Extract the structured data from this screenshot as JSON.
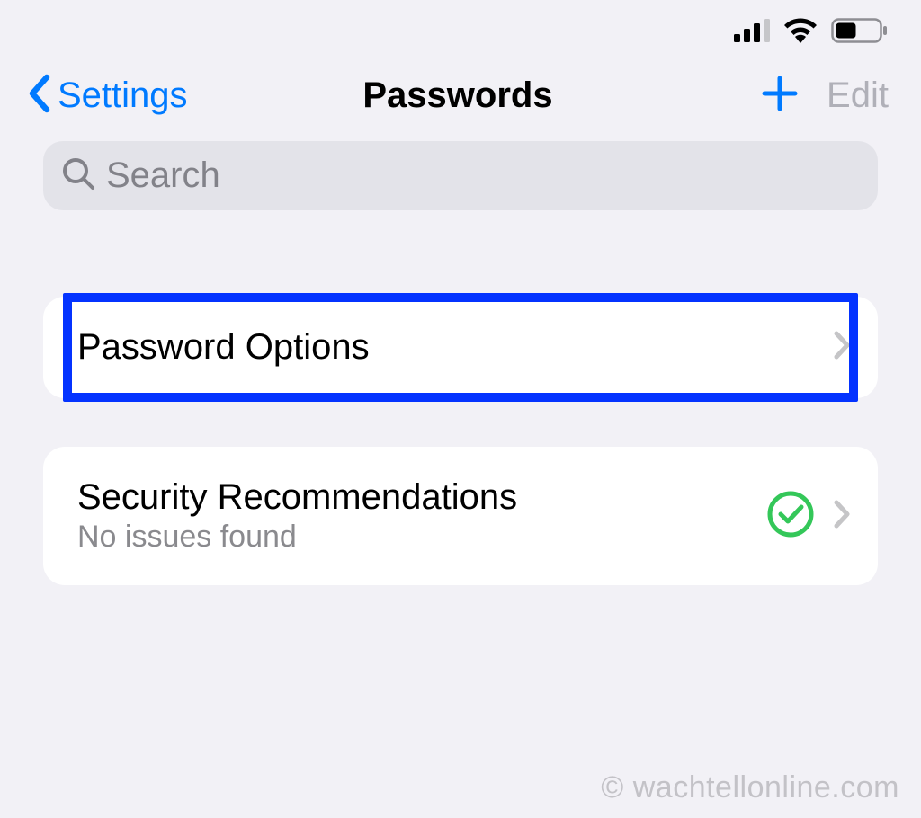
{
  "nav": {
    "back_label": "Settings",
    "title": "Passwords",
    "edit_label": "Edit"
  },
  "search": {
    "placeholder": "Search"
  },
  "rows": {
    "password_options": {
      "title": "Password Options"
    },
    "security_recommendations": {
      "title": "Security Recommendations",
      "subtitle": "No issues found"
    }
  },
  "watermark": "© wachtellonline.com"
}
